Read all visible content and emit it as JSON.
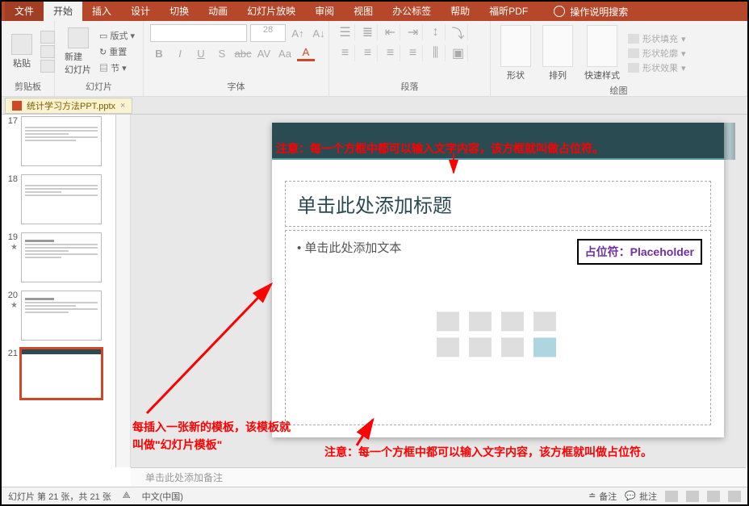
{
  "menu": {
    "file": "文件",
    "home": "开始",
    "insert": "插入",
    "design": "设计",
    "transition": "切换",
    "animation": "动画",
    "slideshow": "幻灯片放映",
    "review": "审阅",
    "view": "视图",
    "office": "办公标签",
    "help": "帮助",
    "foxit": "福昕PDF",
    "search": "操作说明搜索"
  },
  "ribbon": {
    "clipboard": {
      "paste": "粘贴",
      "label": "剪贴板"
    },
    "slides": {
      "new": "新建\n幻灯片",
      "layout": "版式",
      "reset": "重置",
      "section": "节",
      "label": "幻灯片"
    },
    "font": {
      "size": "28",
      "b": "B",
      "i": "I",
      "u": "U",
      "s": "S",
      "abc": "abc",
      "av": "AV",
      "aa": "Aa",
      "a1": "A",
      "label": "字体"
    },
    "paragraph": {
      "label": "段落"
    },
    "drawing": {
      "shape": "形状",
      "arrange": "排列",
      "quick": "快速样式",
      "fill": "形状填充",
      "outline": "形状轮廓",
      "effect": "形状效果",
      "label": "绘图"
    }
  },
  "doc": {
    "name": "统计学习方法PPT.pptx"
  },
  "thumbs": [
    {
      "n": "17"
    },
    {
      "n": "18"
    },
    {
      "n": "19",
      "star": true
    },
    {
      "n": "20",
      "star": true
    },
    {
      "n": "21",
      "sel": true
    }
  ],
  "slide": {
    "title": "单击此处添加标题",
    "bullet": "• 单击此处添加文本",
    "placeholder": "占位符：Placeholder"
  },
  "annotations": {
    "top": "注意：每一个方框中都可以输入文字内容，该方框就叫做占位符。",
    "bottom": "注意：每一个方框中都可以输入文字内容，该方框就叫做占位符。",
    "template": "每插入一张新的模板，该模板就叫做\"幻灯片模板\""
  },
  "notes": "单击此处添加备注",
  "status": {
    "slide": "幻灯片 第 21 张，共 21 张",
    "lang": "中文(中国)",
    "notes": "备注",
    "comments": "批注"
  }
}
